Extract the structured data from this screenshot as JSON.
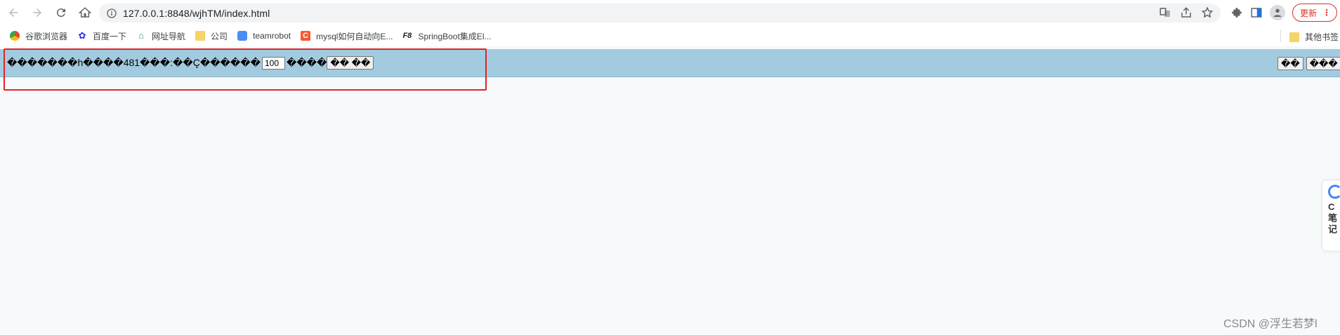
{
  "browser": {
    "url": "127.0.0.1:8848/wjhTM/index.html",
    "update_label": "更新",
    "menu_label": "⋮"
  },
  "bookmarks": [
    {
      "label": "谷歌浏览器",
      "icon": "chrome-icon"
    },
    {
      "label": "百度一下",
      "icon": "baidu-icon"
    },
    {
      "label": "网址导航",
      "icon": "home-nav-icon"
    },
    {
      "label": "公司",
      "icon": "folder-icon"
    },
    {
      "label": "teamrobot",
      "icon": "teamrobot-icon"
    },
    {
      "label": "mysql如何自动向E...",
      "icon": "csdn-icon"
    },
    {
      "label": "SpringBoot集成El...",
      "icon": "f8-icon"
    }
  ],
  "other_bookmarks": "其他书签",
  "page": {
    "text_before_input": "�������h����481���:��Ç������",
    "input_value": "100",
    "text_after_input": "����",
    "button_label": "�� ��",
    "right_buttons": [
      "��",
      "���"
    ]
  },
  "side_widget": {
    "lines": [
      "C",
      "笔",
      "记"
    ]
  },
  "watermark": "CSDN @浮生若梦l",
  "colors": {
    "page_bar": "#a3cbe0",
    "page_bg": "#f6fafb",
    "highlight": "#e32227",
    "update": "#d93025"
  }
}
